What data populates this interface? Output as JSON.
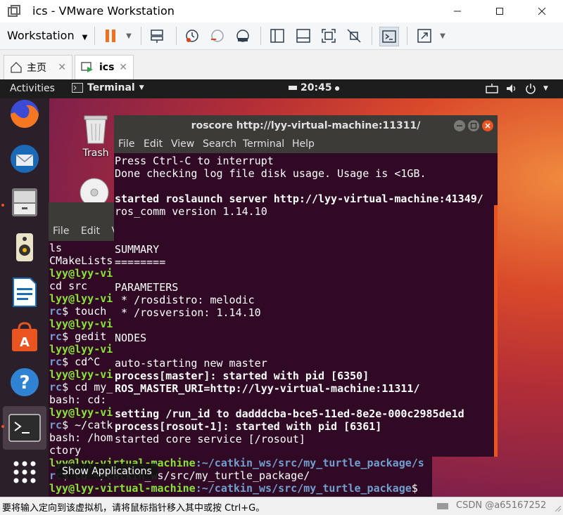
{
  "window": {
    "title": "ics - VMware Workstation"
  },
  "toolbar": {
    "workstation_label": "Workstation"
  },
  "tabs": [
    {
      "label": "主页"
    },
    {
      "label": "ics"
    }
  ],
  "ubuntu_bar": {
    "activities": "Activities",
    "app_menu": "Terminal",
    "clock": "20:45"
  },
  "desktop": {
    "trash_label": "Trash",
    "show_applications_tooltip": "Show Applications"
  },
  "bg_terminal": {
    "menu": [
      "File",
      "Edit",
      "Vi"
    ],
    "lines": [
      {
        "text": "ls",
        "kind": "plain"
      },
      {
        "text": "CMakeLists",
        "kind": "plain"
      },
      {
        "prompt": "lyy@lyy-vi",
        "kind": "prompt"
      },
      {
        "text": "cd src",
        "kind": "plain"
      },
      {
        "prompt": "lyy@lyy-vi",
        "kind": "prompt"
      },
      {
        "text": "rc$ touch ",
        "kind": "cmd"
      },
      {
        "prompt": "lyy@lyy-vi",
        "kind": "prompt"
      },
      {
        "text": "rc$ gedit",
        "kind": "cmd"
      },
      {
        "prompt": "lyy@lyy-vi",
        "kind": "prompt"
      },
      {
        "text": "rc$ cd^C",
        "kind": "cmd"
      },
      {
        "prompt": "lyy@lyy-vi",
        "kind": "prompt"
      },
      {
        "text": "rc$ cd my_",
        "kind": "cmd"
      },
      {
        "text": "bash: cd: ",
        "kind": "plain"
      },
      {
        "prompt": "lyy@lyy-vi",
        "kind": "prompt"
      },
      {
        "text": "rc$ ~/catk",
        "kind": "cmd"
      },
      {
        "text": "bash: /hom",
        "kind": "plain"
      },
      {
        "text": "ctory",
        "kind": "plain"
      }
    ],
    "bottom_lines": [
      {
        "user": "lyy@lyy-virtual-machine",
        "path": ":~/catkin_ws/src/my_turtle_package/s"
      },
      {
        "user": "rc",
        "path": "",
        "rest": "$ cd ~/catkin_ws/src/my_turtle_package/"
      },
      {
        "user": "lyy@lyy-virtual-machine",
        "path": ":~/catkin_ws/src/my_turtle_package",
        "rest": "$"
      }
    ]
  },
  "ros_terminal": {
    "title": "roscore http://lyy-virtual-machine:11311/",
    "menu": [
      "File",
      "Edit",
      "View",
      "Search",
      "Terminal",
      "Help"
    ],
    "lines": [
      {
        "text": "Press Ctrl-C to interrupt",
        "bold": false
      },
      {
        "text": "Done checking log file disk usage. Usage is <1GB.",
        "bold": false
      },
      {
        "text": "",
        "bold": false
      },
      {
        "text": "started roslaunch server http://lyy-virtual-machine:41349/",
        "bold": true
      },
      {
        "text": "ros_comm version 1.14.10",
        "bold": false
      },
      {
        "text": "",
        "bold": false
      },
      {
        "text": "",
        "bold": false
      },
      {
        "text": "SUMMARY",
        "bold": false
      },
      {
        "text": "========",
        "bold": false
      },
      {
        "text": "",
        "bold": false
      },
      {
        "text": "PARAMETERS",
        "bold": false
      },
      {
        "text": " * /rosdistro: melodic",
        "bold": false
      },
      {
        "text": " * /rosversion: 1.14.10",
        "bold": false
      },
      {
        "text": "",
        "bold": false
      },
      {
        "text": "NODES",
        "bold": false
      },
      {
        "text": "",
        "bold": false
      },
      {
        "text": "auto-starting new master",
        "bold": false
      },
      {
        "text": "process[master]: started with pid [6350]",
        "bold": true
      },
      {
        "text": "ROS_MASTER_URI=http://lyy-virtual-machine:11311/",
        "bold": true
      },
      {
        "text": "",
        "bold": false
      },
      {
        "text": "setting /run_id to dadddcba-bce5-11ed-8e2e-000c2985de1d",
        "bold": true
      },
      {
        "text": "process[rosout-1]: started with pid [6361]",
        "bold": true
      },
      {
        "text": "started core service [/rosout]",
        "bold": false
      }
    ]
  },
  "status_bar": {
    "message": "要将输入定向到该虚拟机，请将鼠标指针移入其中或按 Ctrl+G。",
    "watermark": "CSDN @a65167252"
  },
  "colors": {
    "ubuntu_orange": "#e95420",
    "terminal_bg": "#300a24",
    "prompt_green": "#8ae234",
    "path_blue": "#729fcf"
  }
}
